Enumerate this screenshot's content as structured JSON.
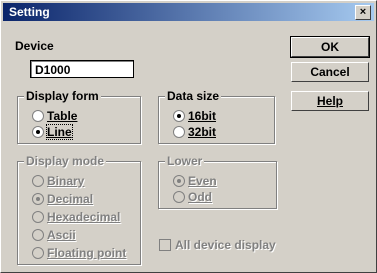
{
  "title": "Setting",
  "close_glyph": "×",
  "device": {
    "label": "Device",
    "value": "D1000"
  },
  "buttons": {
    "ok": "OK",
    "cancel": "Cancel",
    "help": "Help"
  },
  "display_form": {
    "title": "Display form",
    "options": [
      "Table",
      "Line"
    ],
    "selected": "Line"
  },
  "data_size": {
    "title": "Data size",
    "options": [
      "16bit",
      "32bit"
    ],
    "selected": "16bit"
  },
  "display_mode": {
    "title": "Display mode",
    "options": [
      "Binary",
      "Decimal",
      "Hexadecimal",
      "Ascii",
      "Floating point"
    ],
    "selected": "Decimal"
  },
  "lower": {
    "title": "Lower",
    "options": [
      "Even",
      "Odd"
    ],
    "selected": "Even"
  },
  "all_device_display": {
    "label": "All device display",
    "checked": false
  }
}
